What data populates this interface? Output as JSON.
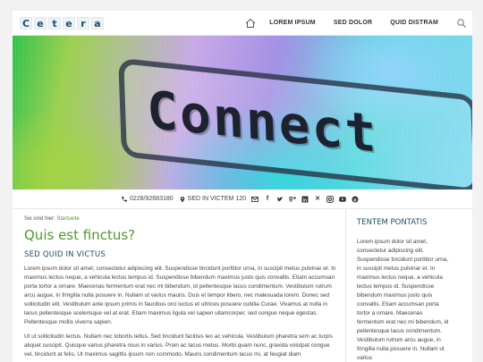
{
  "header": {
    "logo_letters": [
      "C",
      "e",
      "t",
      "e",
      "r",
      "a"
    ],
    "nav": [
      "LOREM IPSUM",
      "SED DOLOR",
      "QUID DISTRAM"
    ]
  },
  "hero": {
    "word": "Connect"
  },
  "contact": {
    "phone": "0228/92683180",
    "address": "SED IN VICTEM 120",
    "socials": [
      "mail",
      "facebook",
      "twitter",
      "google-plus",
      "linkedin",
      "xing",
      "instagram",
      "youtube",
      "pinterest"
    ]
  },
  "breadcrumb": {
    "prefix": "Sie sind hier:",
    "link": "Startseite"
  },
  "main": {
    "title": "Quis est finctus?",
    "subtitle": "SED QUID IN VICTUS",
    "paragraphs": [
      "Lorem ipsum dolor sit amet, consectetur adipiscing elit. Suspendisse tincidunt porttitor urna, in suscipit metus pulvinar et. In maximus lectus neque, a vehicula lectus tempus id. Suspendisse bibendum maximus justo quis convallis. Etiam accumsan porta tortor a ornare. Maecenas fermentum erat nec mi bibendum, id pellentesque lacus condimentum. Vestibulum rutrum arcu augue, in fringilla nulla posuere in. Nullam ut varius mauris. Duis et tempor libero, nec malesuada lorem. Donec sed sollicitudin elit. Vestibulum ante ipsum primis in faucibus orci luctus et ultrices posuere cubilia Curae; Vivamus at nulla in lacus pellentesque scelerisque vel at erat. Etiam maximus ligula vel sapien ullamcorper, sed congue neque egestas. Pellentesque mollis viverra sapien.",
      "Ut ut sollicitudin lectus. Nullam nec lobortis tellus. Sed tincidunt facilisis leo ac vehicula. Vestibulum pharetra sem ac turpis aliquet suscipit. Quisque varius pharetra risus in varius. Proin ac lacus metus. Morbi quam nunc, gravida volutpat congue vel, tincidunt at felis. Ut maximus sagittis ipsum non commodo. Mauris condimentum lacus mi, at feugiat diam"
    ]
  },
  "sidebar": {
    "title": "TENTEM PONTATIS",
    "text": "Lorem ipsum dolor sit amet, consectetur adipiscing elit. Suspendisse tincidunt porttitor urna, in suscipit metus pulvinar et. In maximus lectus neque, a vehicula lectus tempus id. Suspendisse bibendum maximus justo quis convallis. Etiam accumsan porta tortor a ornare. Maecenas fermentum erat nec mi bibendum, id pellentesque lacus condimentum. Vestibulum rutrum arcu augue, in fringilla nulla posuere in. Nullam ut varius"
  },
  "colors": {
    "brand": "#1e4d6b",
    "accent_green": "#4e9a2a"
  }
}
